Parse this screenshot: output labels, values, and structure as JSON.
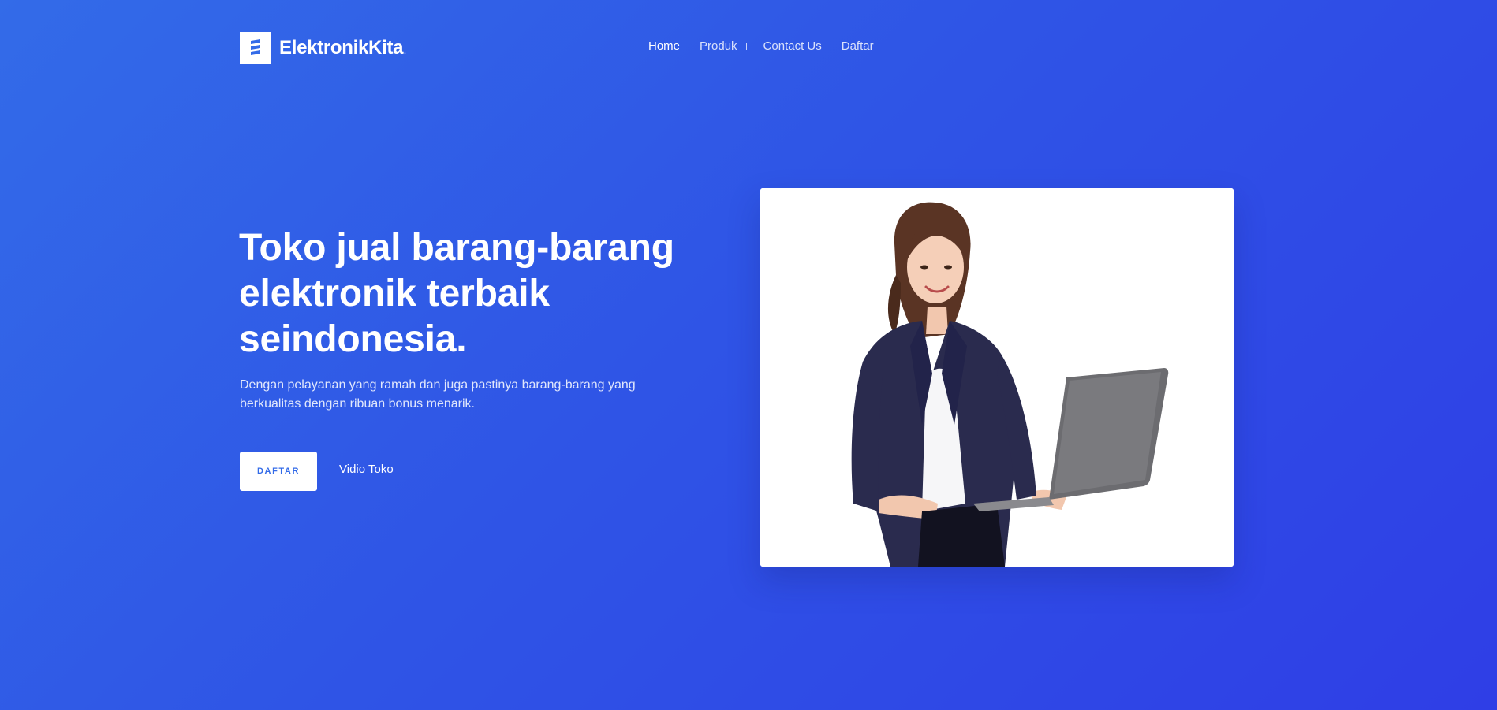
{
  "header": {
    "brand": "ElektronikKita",
    "brand_suffix": ".",
    "nav": [
      {
        "label": "Home",
        "active": true
      },
      {
        "label": "Produk",
        "has_dropdown": true
      },
      {
        "label": "Contact Us"
      },
      {
        "label": "Daftar"
      }
    ]
  },
  "hero": {
    "title": "Toko jual barang-barang elektronik terbaik seindonesia.",
    "subtitle": "Dengan pelayanan yang ramah dan juga pastinya barang-barang yang berkualitas dengan ribuan bonus menarik.",
    "cta_label": "DAFTAR",
    "video_link_label": "Vidio Toko",
    "image_subject": "woman-holding-laptop"
  },
  "colors": {
    "background_start": "#336be8",
    "background_end": "#2f3ee6",
    "accent": "#336be8",
    "text": "#ffffff"
  },
  "icons": {
    "logo": "stacked-bars-logo-icon",
    "dropdown": "chevron-down-icon"
  }
}
